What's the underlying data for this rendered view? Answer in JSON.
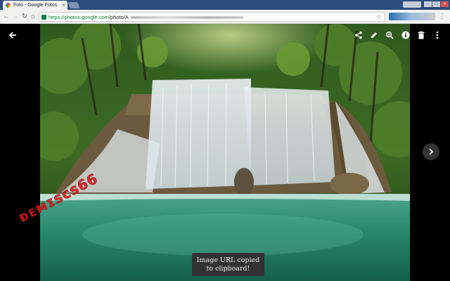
{
  "browser": {
    "tab_title": "Foto - Google Fotos",
    "tab_close": "×",
    "url_domain": "https://photos.google.com",
    "url_path": "/photo/A",
    "star": "☆",
    "menu": "⋮"
  },
  "viewer": {
    "toast": "Image URL copied to clipboard!",
    "icons": [
      "back-arrow-icon",
      "share-icon",
      "edit-icon",
      "zoom-icon",
      "info-icon",
      "delete-icon",
      "more-icon",
      "next-icon"
    ]
  },
  "watermark": {
    "text": "ᴆᴇᴍɪscs66",
    "color": "#e0181b"
  },
  "colors": {
    "tabstrip": "#2b4d7f",
    "url_green": "#0b8043",
    "toast_bg": "#323232"
  }
}
